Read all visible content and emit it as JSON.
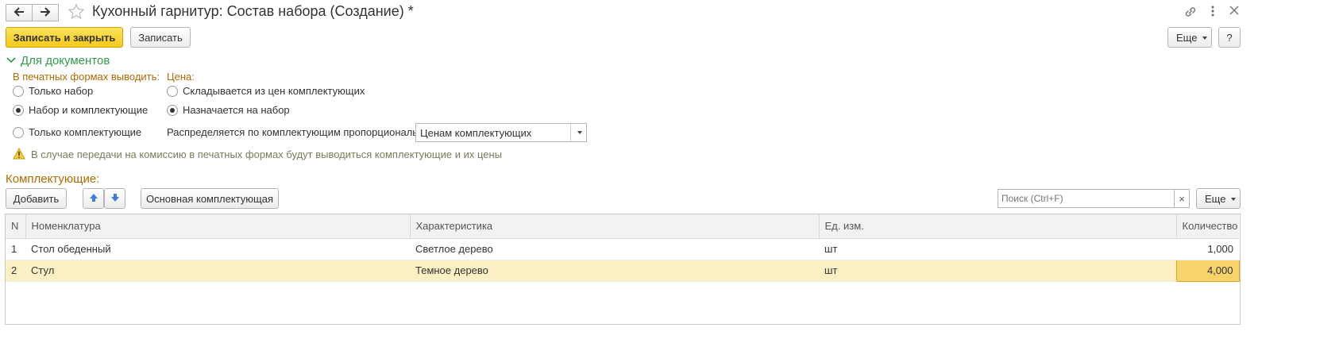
{
  "window": {
    "title": "Кухонный гарнитур: Состав набора (Создание) *"
  },
  "toolbar": {
    "save_close_label": "Записать и закрыть",
    "save_label": "Записать",
    "more_label": "Еще",
    "help_label": "?"
  },
  "section": {
    "title": "Для документов"
  },
  "print_forms": {
    "label": "В печатных формах выводить:",
    "options": [
      {
        "label": "Только набор",
        "checked": false
      },
      {
        "label": "Набор и комплектующие",
        "checked": true
      },
      {
        "label": "Только комплектующие",
        "checked": false
      }
    ]
  },
  "price": {
    "label": "Цена:",
    "options": [
      {
        "label": "Складывается из цен комплектующих",
        "checked": false
      },
      {
        "label": "Назначается на набор",
        "checked": true
      }
    ],
    "distribute_label": "Распределяется по комплектующим пропорционально:",
    "distribute_value": "Ценам комплектующих"
  },
  "warning": {
    "text": "В случае передачи на комиссию в печатных формах будут выводиться комплектующие и их цены"
  },
  "components": {
    "title": "Комплектующие:",
    "add_label": "Добавить",
    "main_component_label": "Основная комплектующая",
    "search_placeholder": "Поиск (Ctrl+F)",
    "clear_label": "×",
    "more_label": "Еще",
    "columns": [
      "N",
      "Номенклатура",
      "Характеристика",
      "Ед. изм.",
      "Количество"
    ],
    "rows": [
      {
        "n": "1",
        "item": "Стол обеденный",
        "characteristic": "Светлое дерево",
        "unit": "шт",
        "qty": "1,000"
      },
      {
        "n": "2",
        "item": "Стул",
        "characteristic": "Темное дерево",
        "unit": "шт",
        "qty": "4,000"
      }
    ]
  },
  "colors": {
    "accent_yellow": "#f5c918",
    "section_green": "#2e9c4a",
    "label_orange": "#b36a00",
    "selected_row": "#fbf0c3",
    "selected_cell": "#f7d36c"
  }
}
